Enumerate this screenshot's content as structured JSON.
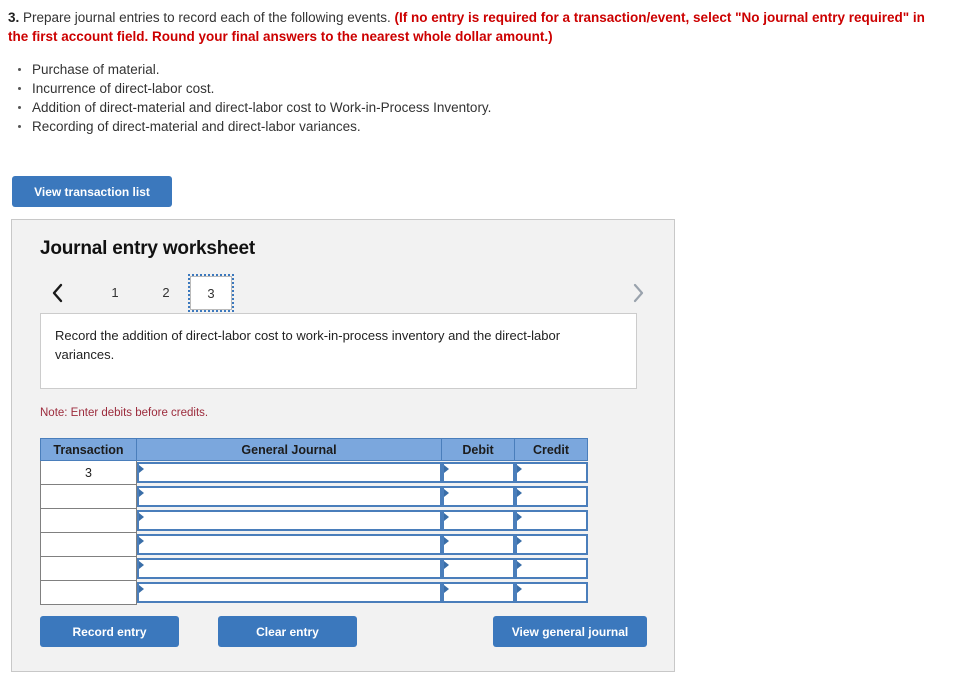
{
  "question": {
    "number": "3.",
    "prompt": " Prepare journal entries to record each of the following events. ",
    "red_instruction": "(If no entry is required for a transaction/event, select \"No journal entry required\" in the first account field. Round your final answers to the nearest whole dollar amount.)",
    "events": [
      "Purchase of material.",
      "Incurrence of direct-labor cost.",
      "Addition of direct-material and direct-labor cost to Work-in-Process Inventory.",
      "Recording of direct-material and direct-labor variances."
    ]
  },
  "buttons": {
    "view_transaction_list": "View transaction list",
    "record_entry": "Record entry",
    "clear_entry": "Clear entry",
    "view_general_journal": "View general journal"
  },
  "worksheet": {
    "title": "Journal entry worksheet",
    "tabs": [
      {
        "label": "1",
        "active": false
      },
      {
        "label": "2",
        "active": false
      },
      {
        "label": "3",
        "active": true
      }
    ],
    "prev_icon": "chevron-left-icon",
    "next_icon": "chevron-right-icon",
    "description": "Record the addition of direct-labor cost to work-in-process inventory and the direct-labor variances.",
    "note": "Note: Enter debits before credits.",
    "table": {
      "headers": [
        "Transaction",
        "General Journal",
        "Debit",
        "Credit"
      ],
      "rows": [
        {
          "transaction": "3",
          "general_journal": "",
          "debit": "",
          "credit": ""
        },
        {
          "transaction": "",
          "general_journal": "",
          "debit": "",
          "credit": ""
        },
        {
          "transaction": "",
          "general_journal": "",
          "debit": "",
          "credit": ""
        },
        {
          "transaction": "",
          "general_journal": "",
          "debit": "",
          "credit": ""
        },
        {
          "transaction": "",
          "general_journal": "",
          "debit": "",
          "credit": ""
        },
        {
          "transaction": "",
          "general_journal": "",
          "debit": "",
          "credit": ""
        }
      ]
    }
  },
  "colors": {
    "button_blue": "#3b78bd",
    "header_blue": "#7ba7dd",
    "field_border_blue": "#4a7ebb",
    "alert_red": "#cc0000",
    "note_red": "#9c2b3c",
    "panel_bg": "#f2f2f2"
  }
}
